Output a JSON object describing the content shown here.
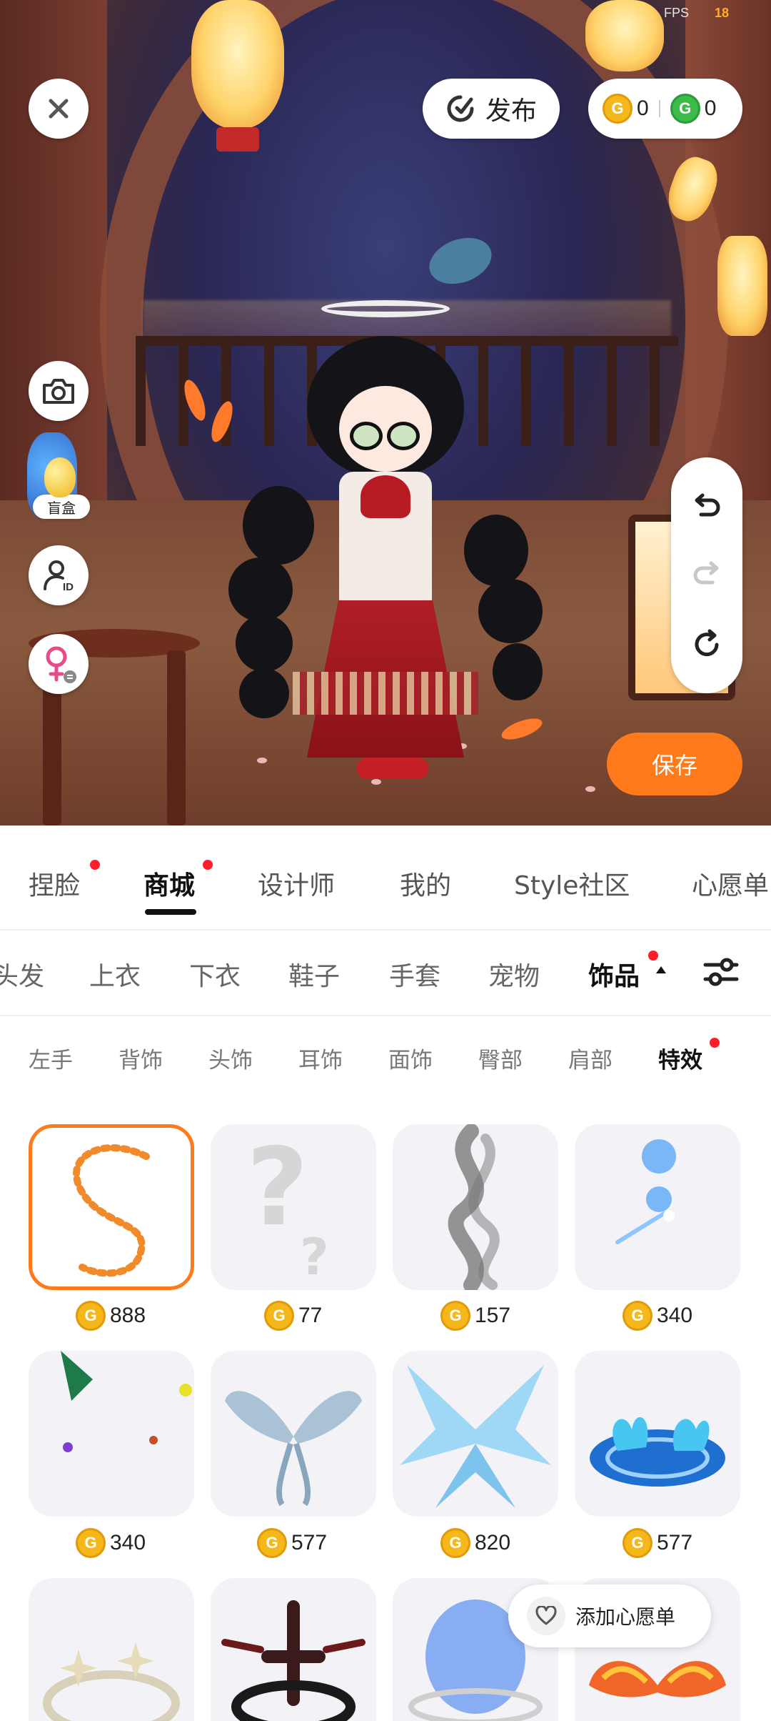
{
  "status": {
    "fps_label": "FPS",
    "fps_value": "18"
  },
  "header": {
    "publish_label": "发布",
    "gold_coins": "0",
    "green_coins": "0",
    "blind_box_label": "盲盒"
  },
  "actions": {
    "save_label": "保存"
  },
  "main_tabs": [
    {
      "label": "捏脸",
      "dot": true
    },
    {
      "label": "商城",
      "dot": true,
      "active": true
    },
    {
      "label": "设计师"
    },
    {
      "label": "我的"
    },
    {
      "label": "Style社区"
    },
    {
      "label": "心愿单"
    }
  ],
  "categories": [
    {
      "label": "头发"
    },
    {
      "label": "上衣"
    },
    {
      "label": "下衣"
    },
    {
      "label": "鞋子"
    },
    {
      "label": "手套"
    },
    {
      "label": "宠物"
    },
    {
      "label": "饰品",
      "active": true,
      "dot": true
    }
  ],
  "subcategories": [
    {
      "label": "左手"
    },
    {
      "label": "背饰"
    },
    {
      "label": "头饰"
    },
    {
      "label": "耳饰"
    },
    {
      "label": "面饰"
    },
    {
      "label": "臀部"
    },
    {
      "label": "肩部"
    },
    {
      "label": "特效",
      "active": true,
      "dot": true
    }
  ],
  "items": [
    {
      "price": "888",
      "selected": true,
      "icon": "fish-swirl-effect"
    },
    {
      "price": "77",
      "icon": "mystery-question-mark"
    },
    {
      "price": "157",
      "icon": "smoke-effect"
    },
    {
      "price": "340",
      "icon": "blue-orb-effect"
    },
    {
      "price": "340",
      "icon": "butterfly-effect"
    },
    {
      "price": "577",
      "icon": "silver-wings"
    },
    {
      "price": "820",
      "icon": "ice-crystal-wings"
    },
    {
      "price": "577",
      "icon": "blue-flame-circle"
    },
    {
      "price": "",
      "icon": "white-flower-halo"
    },
    {
      "price": "",
      "icon": "dark-thorn-halo"
    },
    {
      "price": "",
      "icon": "blue-portal"
    },
    {
      "price": "",
      "icon": "fire-wings"
    }
  ],
  "wishlist": {
    "label": "添加心愿单"
  },
  "colors": {
    "accent": "#ff7a1a",
    "dot": "#ff1d2a",
    "coin_gold": "#f6b71a",
    "coin_green": "#3dbb4a"
  }
}
